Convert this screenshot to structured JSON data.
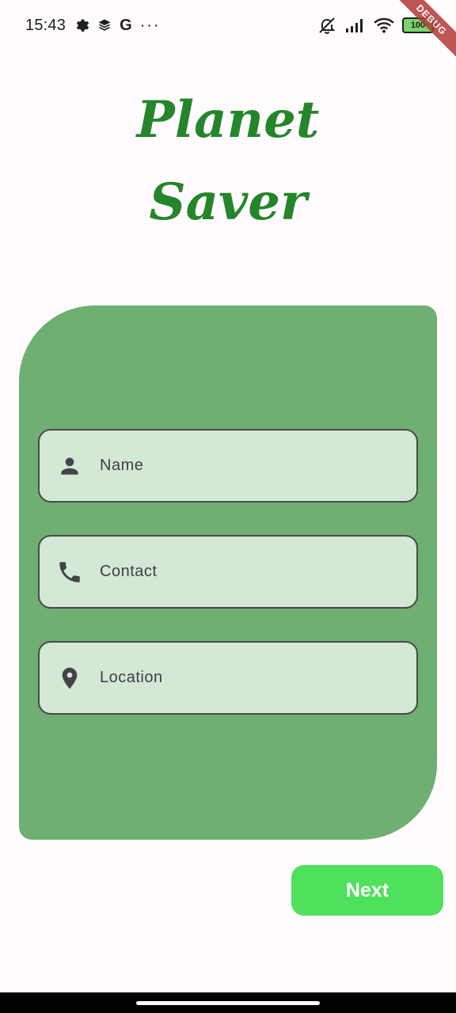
{
  "status_bar": {
    "time": "15:43",
    "left_icons": [
      "settings-icon",
      "layers-icon",
      "google-icon"
    ],
    "google_letter": "G",
    "more": "···",
    "right_icons": [
      "mute-icon",
      "signal-icon",
      "wifi-icon",
      "battery-icon"
    ],
    "battery": "100"
  },
  "debug_banner": "DEBUG",
  "app_title": {
    "line1": "Planet",
    "line2": "Saver"
  },
  "form": {
    "fields": [
      {
        "label": "Name",
        "icon": "person-icon"
      },
      {
        "label": "Contact",
        "icon": "phone-icon"
      },
      {
        "label": "Location",
        "icon": "location-pin-icon"
      }
    ]
  },
  "actions": {
    "next_label": "Next"
  },
  "colors": {
    "title": "#25852a",
    "card": "#6faf71",
    "field_bg": "#d4e8d6",
    "next_button": "#4fe05c",
    "background": "#fffbfe"
  }
}
